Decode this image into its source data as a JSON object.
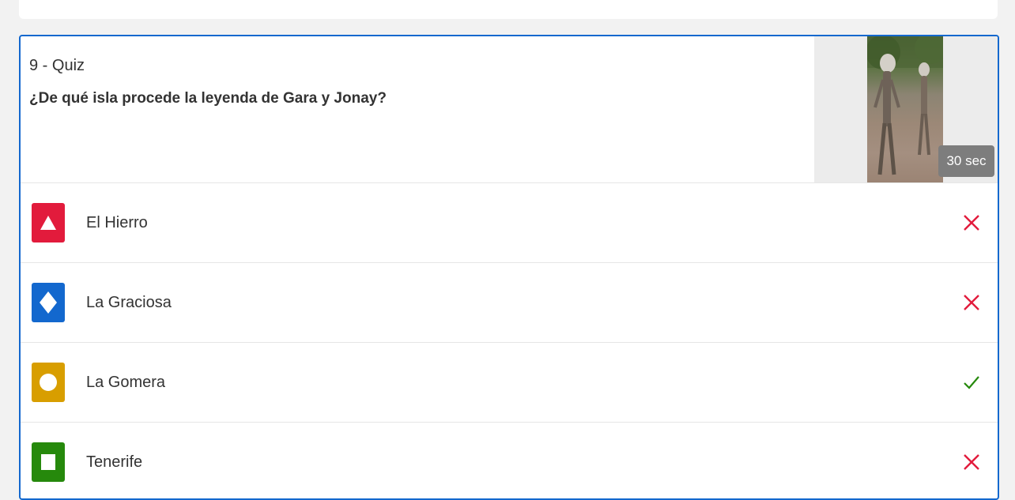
{
  "question": {
    "number_label": "9 - Quiz",
    "text": "¿De qué isla procede la leyenda de Gara y Jonay?",
    "time_label": "30 sec"
  },
  "answers": [
    {
      "label": "El Hierro",
      "shape": "triangle-icon",
      "color": "#e21b3c",
      "correct": false
    },
    {
      "label": "La Graciosa",
      "shape": "diamond-icon",
      "color": "#1368ce",
      "correct": false
    },
    {
      "label": "La Gomera",
      "shape": "circle-icon",
      "color": "#d89e00",
      "correct": true
    },
    {
      "label": "Tenerife",
      "shape": "square-icon",
      "color": "#26890c",
      "correct": false
    }
  ],
  "colors": {
    "accent_border": "#1368ce",
    "wrong": "#e21b3c",
    "correct": "#26890c"
  }
}
